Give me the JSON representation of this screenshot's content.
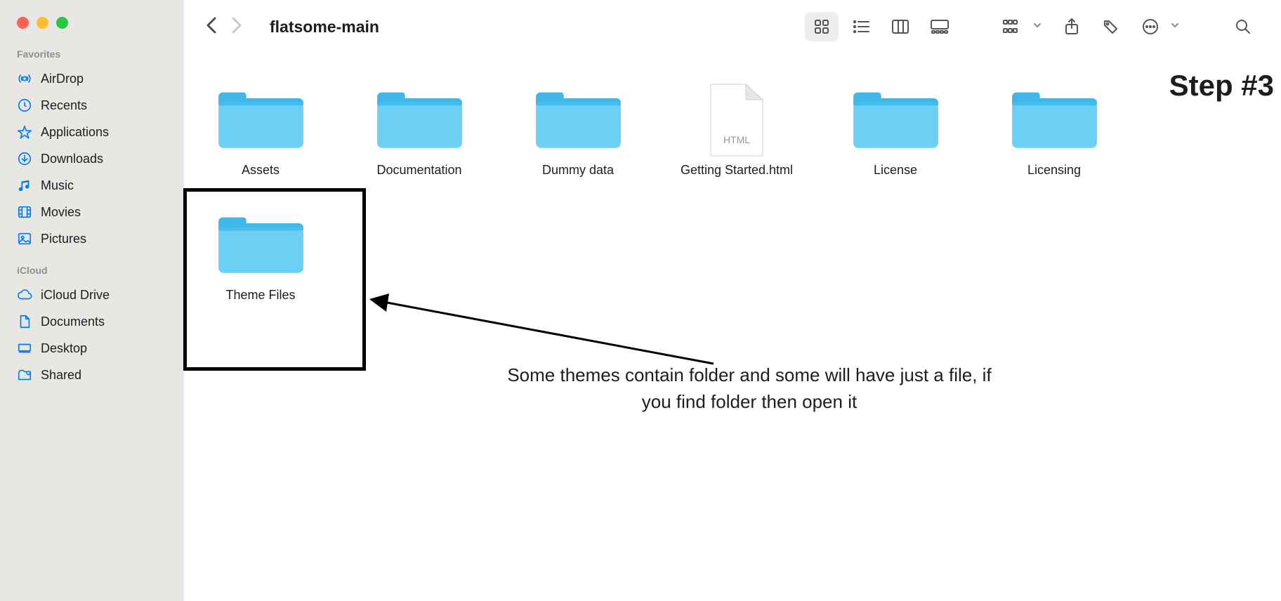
{
  "title": "flatsome-main",
  "sidebar": {
    "favorites_label": "Favorites",
    "icloud_label": "iCloud",
    "favorites": [
      {
        "label": "AirDrop",
        "icon": "airdrop"
      },
      {
        "label": "Recents",
        "icon": "recents"
      },
      {
        "label": "Applications",
        "icon": "applications"
      },
      {
        "label": "Downloads",
        "icon": "downloads"
      },
      {
        "label": "Music",
        "icon": "music"
      },
      {
        "label": "Movies",
        "icon": "movies"
      },
      {
        "label": "Pictures",
        "icon": "pictures"
      }
    ],
    "icloud": [
      {
        "label": "iCloud Drive",
        "icon": "cloud"
      },
      {
        "label": "Documents",
        "icon": "document"
      },
      {
        "label": "Desktop",
        "icon": "desktop"
      },
      {
        "label": "Shared",
        "icon": "shared"
      }
    ]
  },
  "items": [
    {
      "label": "Assets",
      "type": "folder"
    },
    {
      "label": "Documentation",
      "type": "folder"
    },
    {
      "label": "Dummy data",
      "type": "folder"
    },
    {
      "label": "Getting Started.html",
      "type": "html"
    },
    {
      "label": "License",
      "type": "folder"
    },
    {
      "label": "Licensing",
      "type": "folder"
    },
    {
      "label": "Theme Files",
      "type": "folder"
    }
  ],
  "file_badge": "HTML",
  "annotations": {
    "step": "Step #3",
    "text": "Some themes contain folder and some will have just a file, if you find folder then open it"
  }
}
